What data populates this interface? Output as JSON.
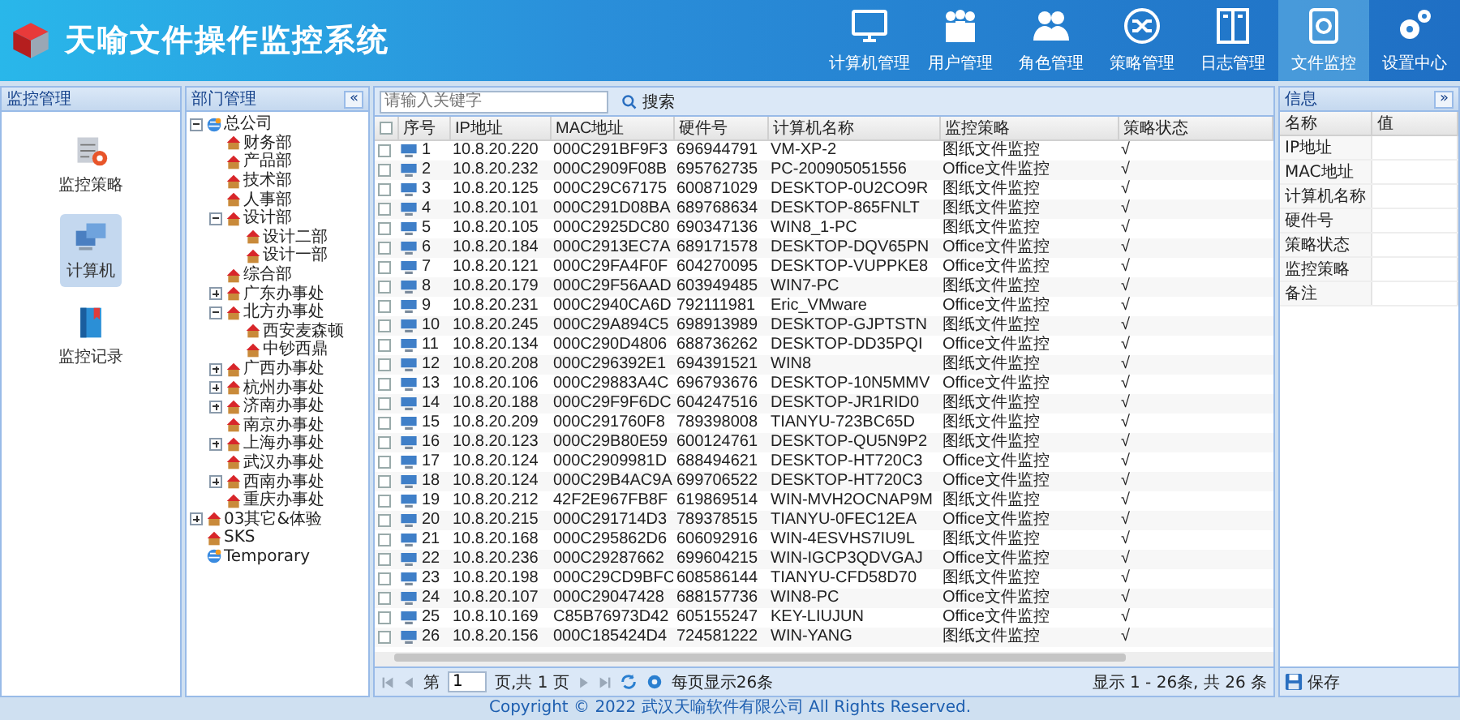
{
  "app": {
    "title": "天喻文件操作监控系统"
  },
  "nav": [
    {
      "label": "计算机管理",
      "kind": "monitor",
      "selected": false
    },
    {
      "label": "用户管理",
      "kind": "users",
      "selected": false
    },
    {
      "label": "角色管理",
      "kind": "roles",
      "selected": false
    },
    {
      "label": "策略管理",
      "kind": "shuffle",
      "selected": false
    },
    {
      "label": "日志管理",
      "kind": "book",
      "selected": false
    },
    {
      "label": "文件监控",
      "kind": "disc",
      "selected": true
    },
    {
      "label": "设置中心",
      "kind": "gears",
      "selected": false
    }
  ],
  "monitor_panel": {
    "title": "监控管理",
    "items": [
      {
        "label": "监控策略",
        "kind": "policy",
        "selected": false
      },
      {
        "label": "计算机",
        "kind": "computer",
        "selected": true
      },
      {
        "label": "监控记录",
        "kind": "record",
        "selected": false
      }
    ]
  },
  "dept_panel": {
    "title": "部门管理",
    "collapse": "«",
    "tree": [
      {
        "label": "总公司",
        "kind": "org",
        "expanded": true,
        "children": [
          {
            "label": "财务部",
            "kind": "dept"
          },
          {
            "label": "产品部",
            "kind": "dept"
          },
          {
            "label": "技术部",
            "kind": "dept"
          },
          {
            "label": "人事部",
            "kind": "dept"
          },
          {
            "label": "设计部",
            "kind": "dept",
            "expanded": true,
            "children": [
              {
                "label": "设计二部",
                "kind": "dept"
              },
              {
                "label": "设计一部",
                "kind": "dept"
              }
            ]
          },
          {
            "label": "综合部",
            "kind": "dept"
          },
          {
            "label": "广东办事处",
            "kind": "dept",
            "expanded": false
          },
          {
            "label": "北方办事处",
            "kind": "dept",
            "expanded": true,
            "children": [
              {
                "label": "西安麦森顿",
                "kind": "dept"
              },
              {
                "label": "中钞西鼎",
                "kind": "dept"
              }
            ]
          },
          {
            "label": "广西办事处",
            "kind": "dept",
            "expanded": false
          },
          {
            "label": "杭州办事处",
            "kind": "dept",
            "expanded": false
          },
          {
            "label": "济南办事处",
            "kind": "dept",
            "expanded": false
          },
          {
            "label": "南京办事处",
            "kind": "dept"
          },
          {
            "label": "上海办事处",
            "kind": "dept",
            "expanded": false
          },
          {
            "label": "武汉办事处",
            "kind": "dept"
          },
          {
            "label": "西南办事处",
            "kind": "dept",
            "expanded": false
          },
          {
            "label": "重庆办事处",
            "kind": "dept"
          }
        ]
      },
      {
        "label": "03其它&体验",
        "kind": "dept",
        "expanded": false
      },
      {
        "label": "SKS",
        "kind": "dept"
      },
      {
        "label": "Temporary",
        "kind": "org"
      }
    ]
  },
  "search": {
    "placeholder": "请输入关键字",
    "button": "搜索"
  },
  "table": {
    "columns": [
      "序号",
      "IP地址",
      "MAC地址",
      "硬件号",
      "计算机名称",
      "监控策略",
      "策略状态"
    ],
    "all_checked": false,
    "rows": [
      {
        "checked": false,
        "cells": [
          "1",
          "10.8.20.220",
          "000C291BF9F3",
          "696944791",
          "VM-XP-2",
          "图纸文件监控",
          "√"
        ]
      },
      {
        "checked": false,
        "cells": [
          "2",
          "10.8.20.232",
          "000C2909F08B",
          "695762735",
          "PC-200905051556",
          "Office文件监控",
          "√"
        ]
      },
      {
        "checked": false,
        "cells": [
          "3",
          "10.8.20.125",
          "000C29C67175",
          "600871029",
          "DESKTOP-0U2CO9R",
          "图纸文件监控",
          "√"
        ]
      },
      {
        "checked": false,
        "cells": [
          "4",
          "10.8.20.101",
          "000C291D08BA",
          "689768634",
          "DESKTOP-865FNLT",
          "图纸文件监控",
          "√"
        ]
      },
      {
        "checked": false,
        "cells": [
          "5",
          "10.8.20.105",
          "000C2925DC80",
          "690347136",
          "WIN8_1-PC",
          "图纸文件监控",
          "√"
        ]
      },
      {
        "checked": false,
        "cells": [
          "6",
          "10.8.20.184",
          "000C2913EC7A",
          "689171578",
          "DESKTOP-DQV65PN",
          "Office文件监控",
          "√"
        ]
      },
      {
        "checked": false,
        "cells": [
          "7",
          "10.8.20.121",
          "000C29FA4F0F",
          "604270095",
          "DESKTOP-VUPPKE8",
          "Office文件监控",
          "√"
        ]
      },
      {
        "checked": false,
        "cells": [
          "8",
          "10.8.20.179",
          "000C29F56AAD",
          "603949485",
          "WIN7-PC",
          "图纸文件监控",
          "√"
        ]
      },
      {
        "checked": false,
        "cells": [
          "9",
          "10.8.20.231",
          "000C2940CA6D",
          "792111981",
          "Eric_VMware",
          "Office文件监控",
          "√"
        ]
      },
      {
        "checked": false,
        "cells": [
          "10",
          "10.8.20.245",
          "000C29A894C5",
          "698913989",
          "DESKTOP-GJPTSTN",
          "图纸文件监控",
          "√"
        ]
      },
      {
        "checked": false,
        "cells": [
          "11",
          "10.8.20.134",
          "000C290D4806",
          "688736262",
          "DESKTOP-DD35PQI",
          "Office文件监控",
          "√"
        ]
      },
      {
        "checked": false,
        "cells": [
          "12",
          "10.8.20.208",
          "000C296392E1",
          "694391521",
          "WIN8",
          "图纸文件监控",
          "√"
        ]
      },
      {
        "checked": false,
        "cells": [
          "13",
          "10.8.20.106",
          "000C29883A4C",
          "696793676",
          "DESKTOP-10N5MMV",
          "Office文件监控",
          "√"
        ]
      },
      {
        "checked": false,
        "cells": [
          "14",
          "10.8.20.188",
          "000C29F9F6DC",
          "604247516",
          "DESKTOP-JR1RID0",
          "图纸文件监控",
          "√"
        ]
      },
      {
        "checked": false,
        "cells": [
          "15",
          "10.8.20.209",
          "000C291760F8",
          "789398008",
          "TIANYU-723BC65D",
          "图纸文件监控",
          "√"
        ]
      },
      {
        "checked": false,
        "cells": [
          "16",
          "10.8.20.123",
          "000C29B80E59",
          "600124761",
          "DESKTOP-QU5N9P2",
          "图纸文件监控",
          "√"
        ]
      },
      {
        "checked": false,
        "cells": [
          "17",
          "10.8.20.124",
          "000C2909981D",
          "688494621",
          "DESKTOP-HT720C3",
          "Office文件监控",
          "√"
        ]
      },
      {
        "checked": false,
        "cells": [
          "18",
          "10.8.20.124",
          "000C29B4AC9A",
          "699706522",
          "DESKTOP-HT720C3",
          "Office文件监控",
          "√"
        ]
      },
      {
        "checked": false,
        "cells": [
          "19",
          "10.8.20.212",
          "42F2E967FB8F",
          "619869514",
          "WIN-MVH2OCNAP9M",
          "图纸文件监控",
          "√"
        ]
      },
      {
        "checked": false,
        "cells": [
          "20",
          "10.8.20.215",
          "000C291714D3",
          "789378515",
          "TIANYU-0FEC12EA",
          "Office文件监控",
          "√"
        ]
      },
      {
        "checked": false,
        "cells": [
          "21",
          "10.8.20.168",
          "000C295862D6",
          "606092916",
          "WIN-4ESVHS7IU9L",
          "图纸文件监控",
          "√"
        ]
      },
      {
        "checked": false,
        "cells": [
          "22",
          "10.8.20.236",
          "000C29287662",
          "699604215",
          "WIN-IGCP3QDVGAJ",
          "Office文件监控",
          "√"
        ]
      },
      {
        "checked": false,
        "cells": [
          "23",
          "10.8.20.198",
          "000C29CD9BFC",
          "608586144",
          "TIANYU-CFD58D70",
          "图纸文件监控",
          "√"
        ]
      },
      {
        "checked": false,
        "cells": [
          "24",
          "10.8.20.107",
          "000C29047428",
          "688157736",
          "WIN8-PC",
          "Office文件监控",
          "√"
        ]
      },
      {
        "checked": false,
        "cells": [
          "25",
          "10.8.10.169",
          "C85B76973D42",
          "605155247",
          "KEY-LIUJUN",
          "Office文件监控",
          "√"
        ]
      },
      {
        "checked": false,
        "cells": [
          "26",
          "10.8.20.156",
          "000C185424D4",
          "724581222",
          "WIN-YANG",
          "图纸文件监控",
          "√"
        ]
      }
    ]
  },
  "pager": {
    "page_prefix": "第",
    "page": "1",
    "page_suffix": "页,共 1 页",
    "per_page": "每页显示26条",
    "summary": "显示 1 - 26条, 共 26 条"
  },
  "info_panel": {
    "title": "信息",
    "expand": "»",
    "columns": [
      "名称",
      "值"
    ],
    "rows": [
      "IP地址",
      "MAC地址",
      "计算机名称",
      "硬件号",
      "策略状态",
      "监控策略",
      "备注"
    ],
    "save": "保存"
  },
  "footer": {
    "copyright": "Copyright © 2022 武汉天喻软件有限公司 All Rights Reserved."
  }
}
